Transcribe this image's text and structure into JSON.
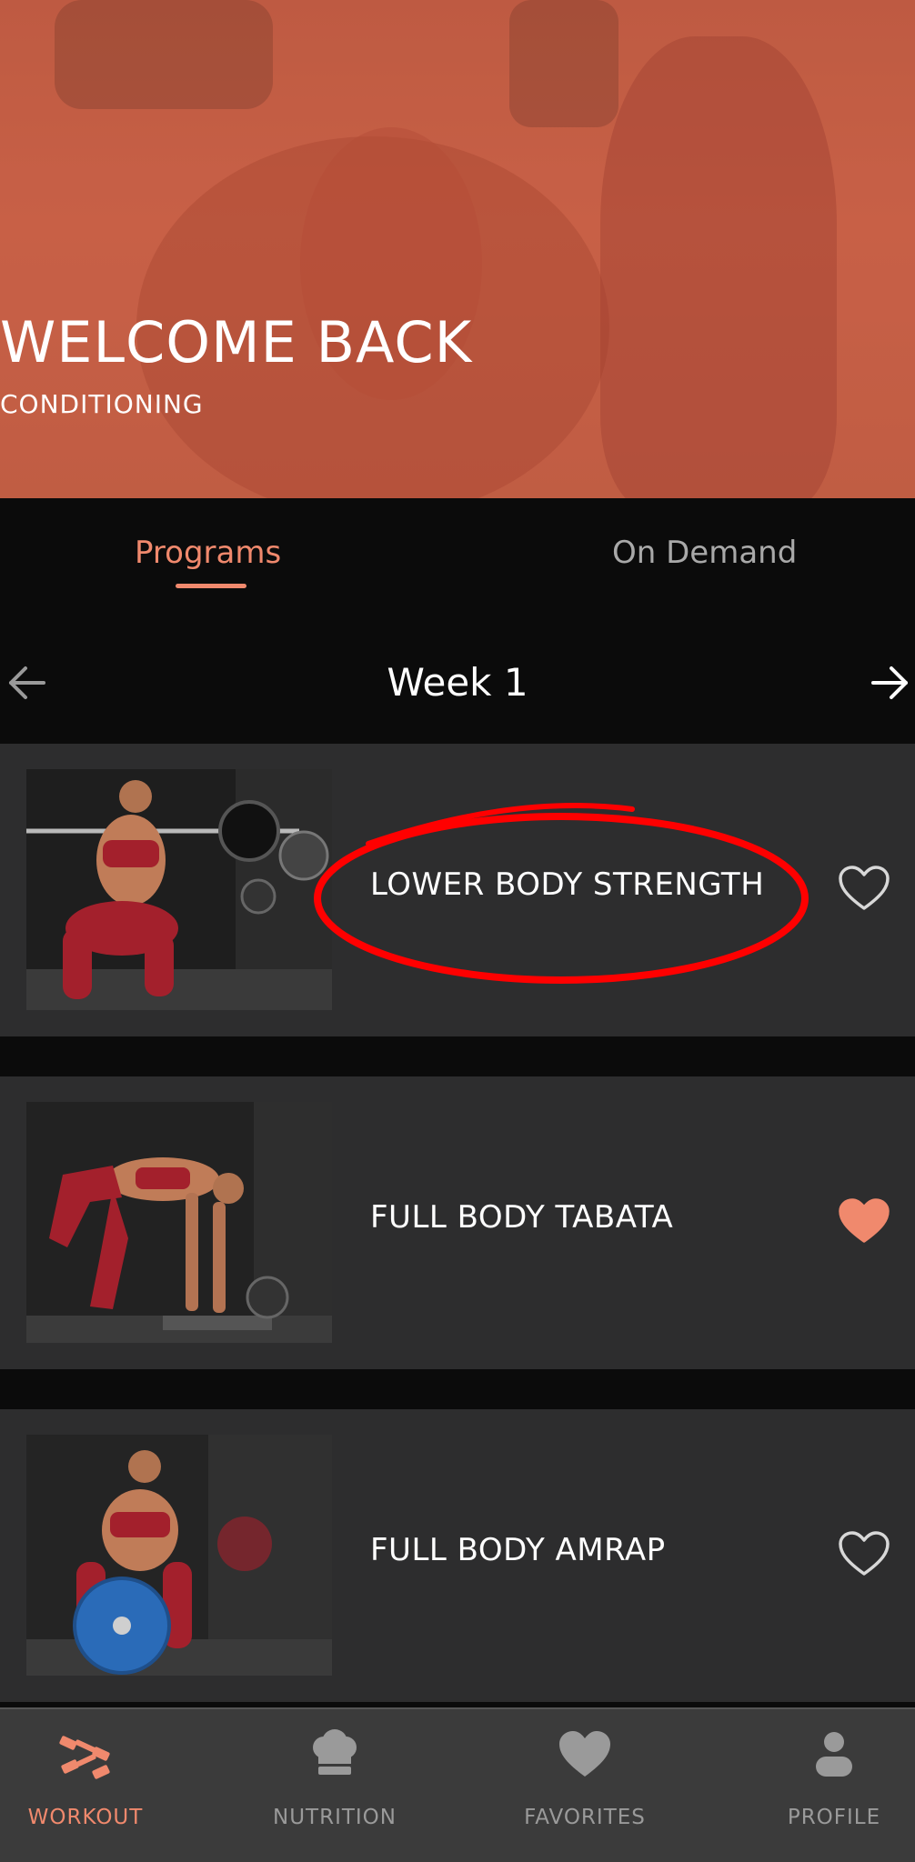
{
  "hero": {
    "title": "WELCOME BACK",
    "subtitle": "CONDITIONING",
    "background_color": "#c25f45"
  },
  "tabs": [
    {
      "label": "Programs",
      "active": true
    },
    {
      "label": "On Demand",
      "active": false
    }
  ],
  "week_nav": {
    "label": "Week 1",
    "prev_icon": "arrow-left-icon",
    "next_icon": "arrow-right-icon"
  },
  "workouts": [
    {
      "title": "LOWER BODY STRENGTH",
      "favorited": false,
      "image": "barbell-squat-photo",
      "highlighted": true
    },
    {
      "title": "FULL BODY TABATA",
      "favorited": true,
      "image": "bench-plank-photo",
      "highlighted": false
    },
    {
      "title": "FULL BODY AMRAP",
      "favorited": false,
      "image": "weight-plate-photo",
      "highlighted": false
    }
  ],
  "bottom_nav": [
    {
      "label": "WORKOUT",
      "icon": "dumbbell-icon",
      "active": true
    },
    {
      "label": "NUTRITION",
      "icon": "chef-hat-icon",
      "active": false
    },
    {
      "label": "FAVORITES",
      "icon": "heart-icon",
      "active": false
    },
    {
      "label": "PROFILE",
      "icon": "person-icon",
      "active": false
    }
  ],
  "colors": {
    "accent": "#f0896d",
    "background": "#0b0b0b",
    "card": "#2d2d2e",
    "nav": "#3b3b3b",
    "inactive": "#9a9a9a",
    "annotation": "#ff0000"
  }
}
